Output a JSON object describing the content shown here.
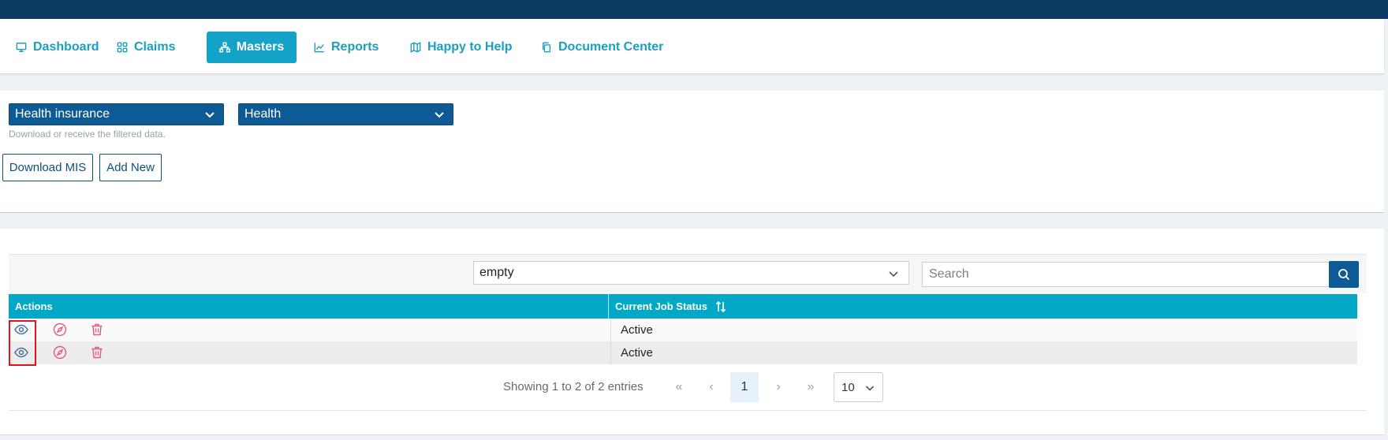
{
  "nav": {
    "items": [
      {
        "label": "Dashboard",
        "icon": "monitor-icon"
      },
      {
        "label": "Claims",
        "icon": "grid-icon"
      },
      {
        "label": "Masters",
        "icon": "sitemap-icon"
      },
      {
        "label": "Reports",
        "icon": "chart-line-icon"
      },
      {
        "label": "Happy to Help",
        "icon": "map-icon"
      },
      {
        "label": "Document Center",
        "icon": "copy-icon"
      }
    ],
    "active": "Masters"
  },
  "filters": {
    "category_value": "Health insurance",
    "subcategory_value": "Health",
    "hint": "Download or receive the filtered data.",
    "download_label": "Download MIS",
    "add_label": "Add New"
  },
  "table": {
    "filter_value": "empty",
    "search_placeholder": "Search",
    "columns": [
      "Actions",
      "Current Job Status"
    ],
    "rows": [
      {
        "status": "Active"
      },
      {
        "status": "Active"
      }
    ],
    "pagination": {
      "summary": "Showing 1 to 2 of 2 entries",
      "first": "«",
      "prev": "‹",
      "current_page": "1",
      "next": "›",
      "last": "»",
      "page_size": "10"
    }
  },
  "colors": {
    "header_bar": "#0b3a63",
    "accent": "#14a3c7",
    "select_bg": "#0e5a94",
    "delete_icon": "#e05a8a",
    "highlight": "#e0141f"
  }
}
